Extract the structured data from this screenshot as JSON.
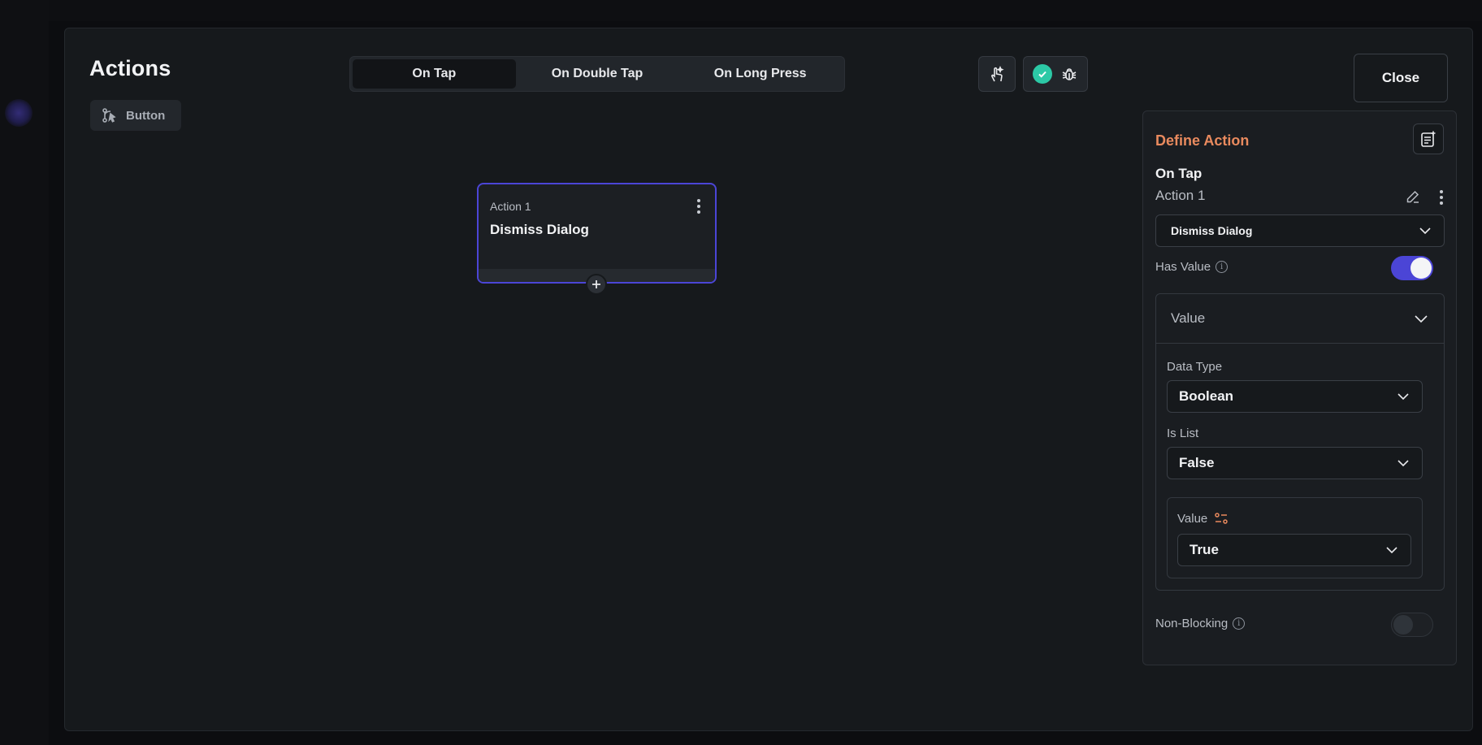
{
  "header": {
    "title": "Actions"
  },
  "trigger_chip": {
    "label": "Button"
  },
  "tabs": [
    {
      "label": "On Tap",
      "active": true
    },
    {
      "label": "On Double Tap",
      "active": false
    },
    {
      "label": "On Long Press",
      "active": false
    }
  ],
  "toolbar": {
    "close_label": "Close"
  },
  "node": {
    "label": "Action 1",
    "title": "Dismiss Dialog"
  },
  "panel": {
    "heading": "Define Action",
    "trigger": "On Tap",
    "action_name": "Action 1",
    "action_type": "Dismiss Dialog",
    "has_value_label": "Has Value",
    "has_value_on": true,
    "value_section": {
      "title": "Value",
      "data_type_label": "Data Type",
      "data_type": "Boolean",
      "is_list_label": "Is List",
      "is_list": "False",
      "value_label": "Value",
      "value": "True"
    },
    "non_blocking_label": "Non-Blocking",
    "non_blocking_on": false
  },
  "colors": {
    "accent": "#4b45d6",
    "heading": "#e98a5e",
    "success": "#2cc9a6"
  }
}
